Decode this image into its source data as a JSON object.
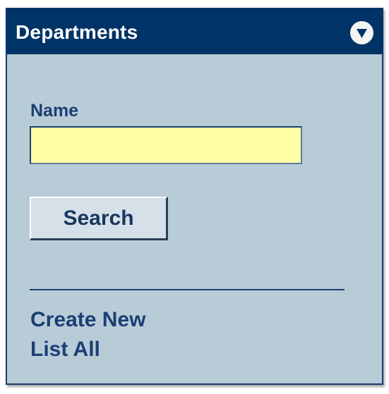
{
  "panel": {
    "title": "Departments",
    "collapse_icon": "chevron-down-circle-icon"
  },
  "search_form": {
    "name_label": "Name",
    "name_value": "",
    "search_label": "Search"
  },
  "actions": {
    "create_new": "Create New",
    "list_all": "List All"
  },
  "colors": {
    "header_bg": "#003366",
    "panel_bg": "#b8ccd8",
    "input_bg": "#ffffa8",
    "text": "#1c3f73"
  }
}
